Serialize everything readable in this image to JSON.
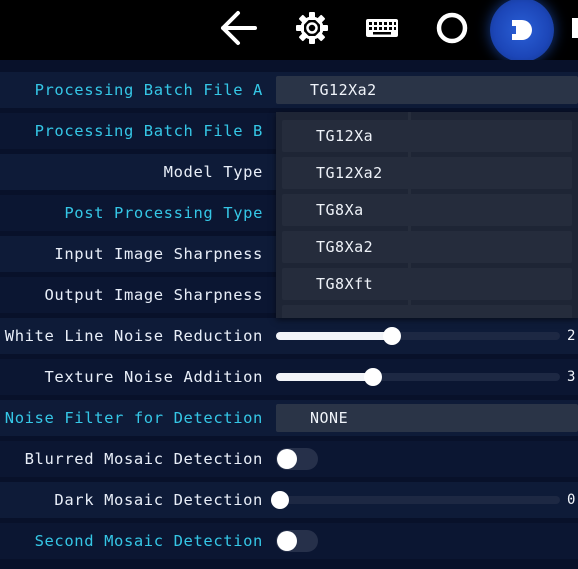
{
  "toolbar": {
    "buttons": [
      {
        "icon": "back-arrow-icon"
      },
      {
        "icon": "gear-icon"
      },
      {
        "icon": "keyboard-icon"
      },
      {
        "icon": "circle-icon"
      },
      {
        "icon": "active-mode-icon",
        "active": true
      }
    ],
    "accent": "#1c46b8"
  },
  "settings": {
    "batch_a": {
      "label": "Processing Batch File A",
      "value": "TG12Xa2"
    },
    "batch_b": {
      "label": "Processing Batch File B"
    },
    "model_type": {
      "label": "Model Type"
    },
    "post_processing": {
      "label": "Post Processing Type"
    },
    "input_sharpness": {
      "label": "Input Image Sharpness"
    },
    "output_sharpness": {
      "label": "Output Image Sharpness"
    },
    "white_line": {
      "label": "White Line Noise Reduction",
      "value": "2",
      "level": 0.41
    },
    "texture_noise": {
      "label": "Texture Noise Addition",
      "value": "3",
      "level": 0.34
    },
    "noise_filter": {
      "label": "Noise Filter for Detection",
      "value": "NONE"
    },
    "blurred_mosaic": {
      "label": "Blurred Mosaic Detection",
      "on": false
    },
    "dark_mosaic": {
      "label": "Dark Mosaic Detection",
      "value": "0",
      "level": 0.0
    },
    "second_mosaic": {
      "label": "Second Mosaic Detection",
      "on": false
    }
  },
  "dropdown_options": [
    "TG12Xa",
    "TG12Xa2",
    "TG8Xa",
    "TG8Xa2",
    "TG8Xft"
  ],
  "colors": {
    "label_cyan": "#35c7e6",
    "label_white": "#e8eef8"
  }
}
